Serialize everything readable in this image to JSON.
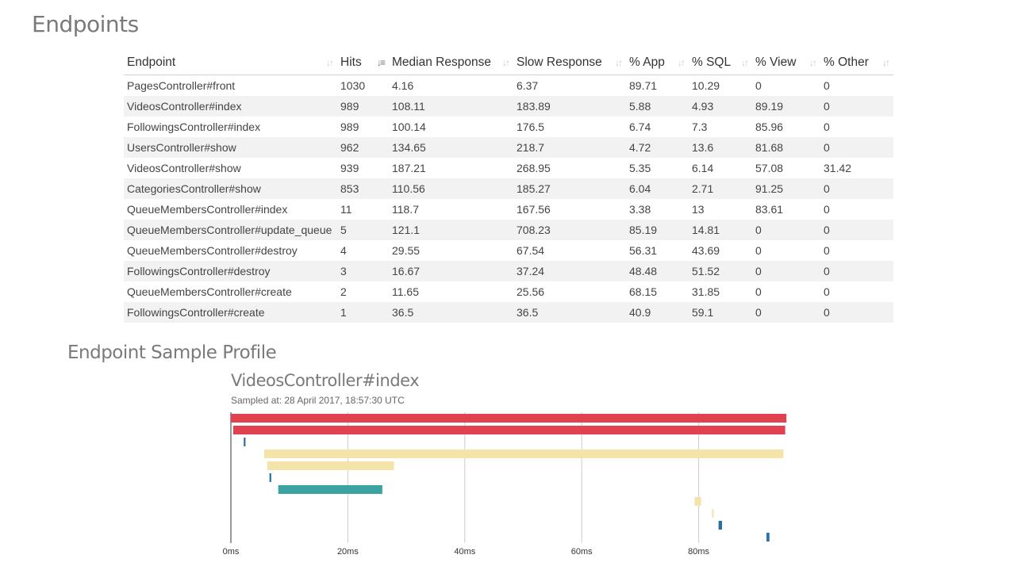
{
  "page": {
    "title": "Endpoints"
  },
  "table": {
    "columns": [
      {
        "label": "Endpoint",
        "sort": "none"
      },
      {
        "label": "Hits",
        "sort": "desc"
      },
      {
        "label": "Median Response",
        "sort": "none"
      },
      {
        "label": "Slow Response",
        "sort": "none"
      },
      {
        "label": "% App",
        "sort": "none"
      },
      {
        "label": "% SQL",
        "sort": "none"
      },
      {
        "label": "% View",
        "sort": "none"
      },
      {
        "label": "% Other",
        "sort": "none"
      }
    ],
    "rows": [
      [
        "PagesController#front",
        "1030",
        "4.16",
        "6.37",
        "89.71",
        "10.29",
        "0",
        "0"
      ],
      [
        "VideosController#index",
        "989",
        "108.11",
        "183.89",
        "5.88",
        "4.93",
        "89.19",
        "0"
      ],
      [
        "FollowingsController#index",
        "989",
        "100.14",
        "176.5",
        "6.74",
        "7.3",
        "85.96",
        "0"
      ],
      [
        "UsersController#show",
        "962",
        "134.65",
        "218.7",
        "4.72",
        "13.6",
        "81.68",
        "0"
      ],
      [
        "VideosController#show",
        "939",
        "187.21",
        "268.95",
        "5.35",
        "6.14",
        "57.08",
        "31.42"
      ],
      [
        "CategoriesController#show",
        "853",
        "110.56",
        "185.27",
        "6.04",
        "2.71",
        "91.25",
        "0"
      ],
      [
        "QueueMembersController#index",
        "11",
        "118.7",
        "167.56",
        "3.38",
        "13",
        "83.61",
        "0"
      ],
      [
        "QueueMembersController#update_queue",
        "5",
        "121.1",
        "708.23",
        "85.19",
        "14.81",
        "0",
        "0"
      ],
      [
        "QueueMembersController#destroy",
        "4",
        "29.55",
        "67.54",
        "56.31",
        "43.69",
        "0",
        "0"
      ],
      [
        "FollowingsController#destroy",
        "3",
        "16.67",
        "37.24",
        "48.48",
        "51.52",
        "0",
        "0"
      ],
      [
        "QueueMembersController#create",
        "2",
        "11.65",
        "25.56",
        "68.15",
        "31.85",
        "0",
        "0"
      ],
      [
        "FollowingsController#create",
        "1",
        "36.5",
        "36.5",
        "40.9",
        "59.1",
        "0",
        "0"
      ]
    ]
  },
  "profile": {
    "heading": "Endpoint Sample Profile",
    "endpoint": "VideosController#index",
    "sampled_at": "Sampled at: 28 April 2017, 18:57:30 UTC"
  },
  "chart_data": {
    "type": "bar",
    "x_ticks": [
      0,
      20,
      40,
      60,
      80
    ],
    "x_tick_labels": [
      "0ms",
      "20ms",
      "40ms",
      "60ms",
      "80ms"
    ],
    "xlim": [
      0,
      95
    ],
    "grid": true,
    "colors": {
      "red": "#e0424f",
      "yellow": "#f5e4a9",
      "teal": "#3da3a0",
      "blue": "#2b6f9e"
    },
    "spans": [
      {
        "row": 0,
        "start": 0.0,
        "end": 95.0,
        "color": "red"
      },
      {
        "row": 1,
        "start": 0.4,
        "end": 94.8,
        "color": "red"
      },
      {
        "row": 2,
        "start": 2.2,
        "end": 2.5,
        "color": "blue"
      },
      {
        "row": 3,
        "start": 5.7,
        "end": 94.5,
        "color": "yellow"
      },
      {
        "row": 4,
        "start": 6.2,
        "end": 27.9,
        "color": "yellow"
      },
      {
        "row": 5,
        "start": 6.6,
        "end": 6.9,
        "color": "blue"
      },
      {
        "row": 6,
        "start": 8.1,
        "end": 25.9,
        "color": "teal"
      },
      {
        "row": 7,
        "start": 79.3,
        "end": 80.4,
        "color": "yellow"
      },
      {
        "row": 8,
        "start": 82.3,
        "end": 82.5,
        "color": "yellow"
      },
      {
        "row": 9,
        "start": 83.4,
        "end": 84.0,
        "color": "blue"
      },
      {
        "row": 10,
        "start": 91.6,
        "end": 92.1,
        "color": "blue"
      }
    ]
  }
}
